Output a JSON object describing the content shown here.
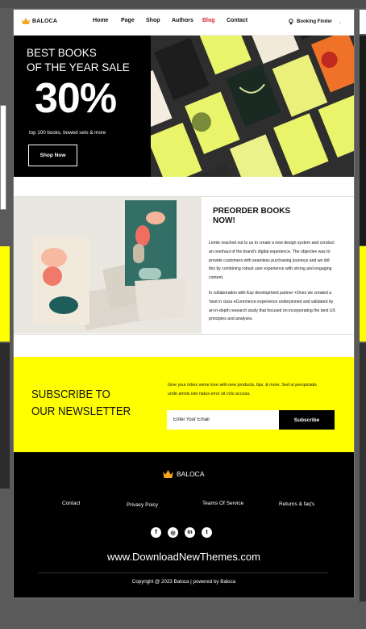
{
  "brand": {
    "name": "BALOCA",
    "accent": "#f5a623"
  },
  "header": {
    "nav": [
      "Home",
      "Page",
      "Shop",
      "Authors",
      "Blog",
      "Contact"
    ],
    "active": "Blog",
    "booking_label": "Booking Finder",
    "extra": ","
  },
  "hero": {
    "title_line1": "BEST BOOKS",
    "title_line2": "OF THE YEAR SALE",
    "discount": "30%",
    "subtitle": "top 100 books, bowed sets & more",
    "button": "Shop Now"
  },
  "preorder": {
    "title_line1": "PREORDER BOOKS",
    "title_line2": "NOW!",
    "paragraph1": "Lemle reached out to us to create a new design system and conduct an overhaul of the brand's digital experience. The objective was to provide customers with seamless purchasing journeys and we did this by combining robust user experience with strong and engaging content.",
    "paragraph2": "In collaboration with Kay development partner +Onex we created a 'best in class eCommerce experience underpinned and validated by an in-depth research study that focused on incorporating the best UX principles and analyses."
  },
  "newsletter": {
    "title_line1": "SUBSCRIBE TO",
    "title_line2": "OUR NEWSLETTER",
    "description": "Give your inbox some love with new products, tips, & more. Sed ut perspiciatis unde amnis iste natus error sit volu accusa.",
    "email_placeholder": "Enter Your Email",
    "button": "Subscribe",
    "bg_color": "#ffff00"
  },
  "footer": {
    "logo": "BALOCA",
    "links": [
      "Contact",
      "Privacy Poicy",
      "Teams Of Service",
      "Returns & faq's"
    ],
    "social": [
      "facebook-icon",
      "instagram-icon",
      "linkedin-icon",
      "twitter-icon"
    ],
    "social_glyphs": [
      "f",
      "◎",
      "in",
      "t"
    ],
    "watermark": "www.DownloadNewThemes.com",
    "copyright": "Copyright @ 2023 Baloca | powered by Baloca"
  }
}
